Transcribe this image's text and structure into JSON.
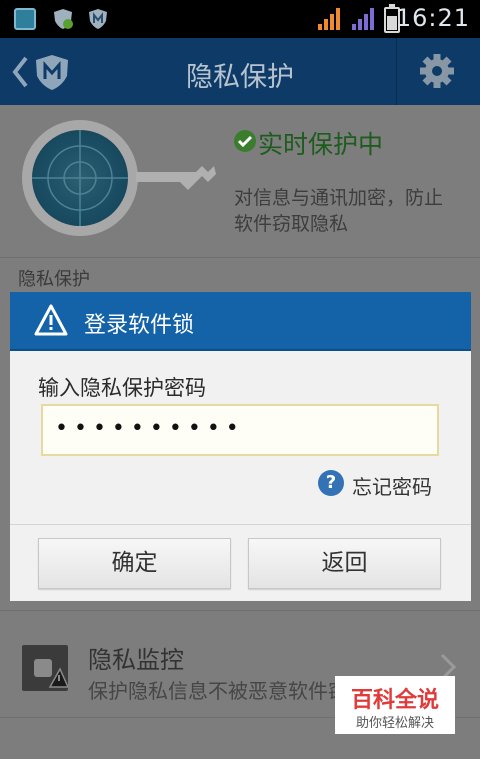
{
  "status_bar": {
    "time": "16:21"
  },
  "title_bar": {
    "title": "隐私保护"
  },
  "protection": {
    "status": "实时保护中",
    "description": "对信息与通讯加密，防止软件窃取隐私"
  },
  "section_label": "隐私保护",
  "monitor": {
    "title": "隐私监控",
    "subtitle": "保护隐私信息不被恶意软件窃取"
  },
  "dialog": {
    "title": "登录软件锁",
    "input_label": "输入隐私保护密码",
    "password_mask": "••••••••••",
    "forgot_label": "忘记密码",
    "confirm_label": "确定",
    "back_label": "返回"
  },
  "watermark": {
    "line1": "百科全说",
    "line2": "助你轻松解决"
  },
  "colors": {
    "title_bar": "#0d3a66",
    "dialog_header": "#1462a8",
    "accent_green": "#3a7d2c"
  }
}
